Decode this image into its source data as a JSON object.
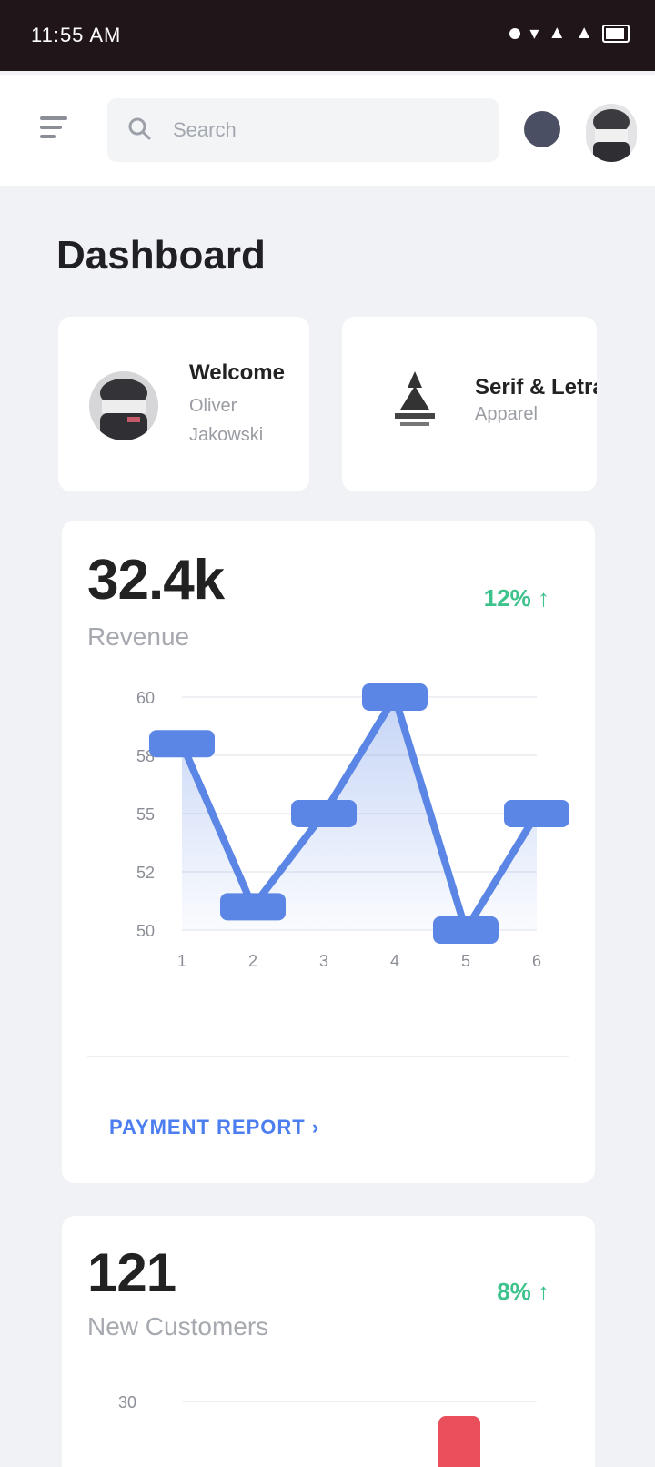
{
  "status_bar": {
    "time": "11:55 AM"
  },
  "header": {
    "search_placeholder": "Search"
  },
  "page": {
    "title": "Dashboard"
  },
  "welcome_card": {
    "title": "Welcome",
    "subtitle": "Oliver Jakowski"
  },
  "company_card": {
    "title": "Serif & Letra",
    "subtitle": "Apparel"
  },
  "revenue_card": {
    "value": "32.4k",
    "label": "Revenue",
    "trend": "12% ↑",
    "link": "PAYMENT REPORT"
  },
  "customers_card": {
    "value": "121",
    "label": "New Customers",
    "trend": "8% ↑"
  },
  "colors": {
    "accent": "#4c7ef0",
    "positive": "#3cc28b",
    "negative": "#e9505c"
  },
  "chart_data": [
    {
      "type": "line",
      "x": [
        "1",
        "2",
        "3",
        "4",
        "5",
        "6"
      ],
      "series": [
        {
          "values": [
            58,
            51,
            55,
            60,
            50,
            55
          ]
        }
      ],
      "y_ticks": [
        "60",
        "58",
        "55",
        "52",
        "50"
      ],
      "ylim": [
        50,
        60
      ],
      "grid": true
    },
    {
      "type": "bar",
      "y_ticks": [
        "30"
      ],
      "ylim": [
        0,
        30
      ]
    }
  ]
}
